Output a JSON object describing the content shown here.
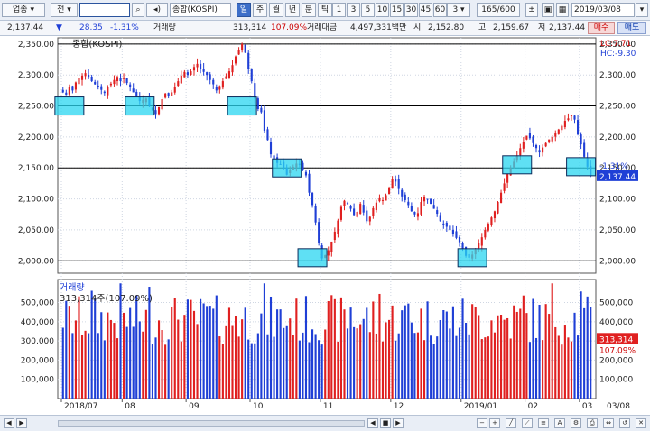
{
  "toolbar": {
    "market_label": "업종",
    "period_label": "전",
    "code": "0001",
    "name": "종합(KOSPI)",
    "mode_buttons": [
      "일",
      "주",
      "월",
      "년",
      "분",
      "틱"
    ],
    "interval_buttons": [
      "1",
      "3",
      "5",
      "10",
      "15",
      "30",
      "45",
      "60"
    ],
    "interval_select": "3",
    "count": "165/600",
    "date": "2019/03/08"
  },
  "infobar": {
    "price": "2,137.44",
    "change": "28.35",
    "change_pct": "-1.31%",
    "volume_label": "거래량",
    "volume": "313,314",
    "volume_pct": "107.09%",
    "amount_label": "거래대금",
    "amount": "4,497,331백만",
    "open_label": "시",
    "open": "2,152.80",
    "high_label": "고",
    "high": "2,159.67",
    "low_label": "저",
    "low": "2,137.44",
    "buy_label": "매수",
    "sell_label": "매도"
  },
  "chart": {
    "price_title": "종합(KOSPI)",
    "lc_label": "LC:7.71",
    "hc_label": "HC:-9.30",
    "current_price": "2,137.44",
    "current_pct": "-1.31%",
    "volume_title": "거래량",
    "volume_summary": "313,314주(107.09%)",
    "current_volume": "313,314",
    "current_volume_pct": "107.09%",
    "x_labels": [
      "2018/07",
      "08",
      "09",
      "10",
      "11",
      "12",
      "2019/01",
      "02",
      "03"
    ],
    "x_label_right": "03/08",
    "colors": {
      "up": "#e02020",
      "down": "#1f3fd6",
      "highlight": "#2ad6f0"
    }
  },
  "chart_data": {
    "type": "candlestick",
    "y_ticks": [
      "2,350.00",
      "2,300.00",
      "2,250.00",
      "2,200.00",
      "2,150.00",
      "2,100.00",
      "2,050.00",
      "2,000.00"
    ],
    "ylim": [
      1980,
      2360
    ],
    "horizontal_levels": [
      2350,
      2250,
      2150,
      2000
    ],
    "volume_ticks": [
      "500,000",
      "400,000",
      "300,000",
      "200,000",
      "100,000"
    ],
    "volume_ylim": [
      0,
      620000
    ],
    "close": [
      2272,
      2268,
      2281,
      2275,
      2288,
      2295,
      2299,
      2303,
      2297,
      2290,
      2285,
      2281,
      2276,
      2271,
      2280,
      2286,
      2292,
      2297,
      2290,
      2295,
      2287,
      2280,
      2272,
      2265,
      2258,
      2260,
      2262,
      2250,
      2243,
      2237,
      2248,
      2261,
      2270,
      2266,
      2272,
      2281,
      2290,
      2299,
      2305,
      2300,
      2306,
      2313,
      2318,
      2310,
      2305,
      2300,
      2292,
      2285,
      2275,
      2282,
      2290,
      2298,
      2306,
      2316,
      2330,
      2340,
      2350,
      2336,
      2310,
      2290,
      2262,
      2245,
      2240,
      2210,
      2195,
      2172,
      2164,
      2158,
      2156,
      2150,
      2139,
      2146,
      2152,
      2157,
      2155,
      2147,
      2138,
      2110,
      2090,
      2062,
      2029,
      2004,
      2009,
      2017,
      2031,
      2047,
      2065,
      2087,
      2097,
      2092,
      2084,
      2074,
      2079,
      2092,
      2078,
      2064,
      2071,
      2085,
      2094,
      2101,
      2098,
      2106,
      2117,
      2132,
      2128,
      2116,
      2104,
      2098,
      2090,
      2080,
      2075,
      2077,
      2095,
      2103,
      2099,
      2092,
      2084,
      2076,
      2064,
      2058,
      2055,
      2050,
      2044,
      2037,
      2030,
      2019,
      2008,
      2005,
      2010,
      2018,
      2028,
      2038,
      2050,
      2060,
      2070,
      2080,
      2095,
      2110,
      2125,
      2140,
      2150,
      2160,
      2170,
      2182,
      2192,
      2202,
      2198,
      2190,
      2182,
      2175,
      2183,
      2190,
      2196,
      2200,
      2206,
      2212,
      2218,
      2226,
      2230,
      2235,
      2228,
      2204,
      2188,
      2168,
      2152,
      2137
    ]
  }
}
